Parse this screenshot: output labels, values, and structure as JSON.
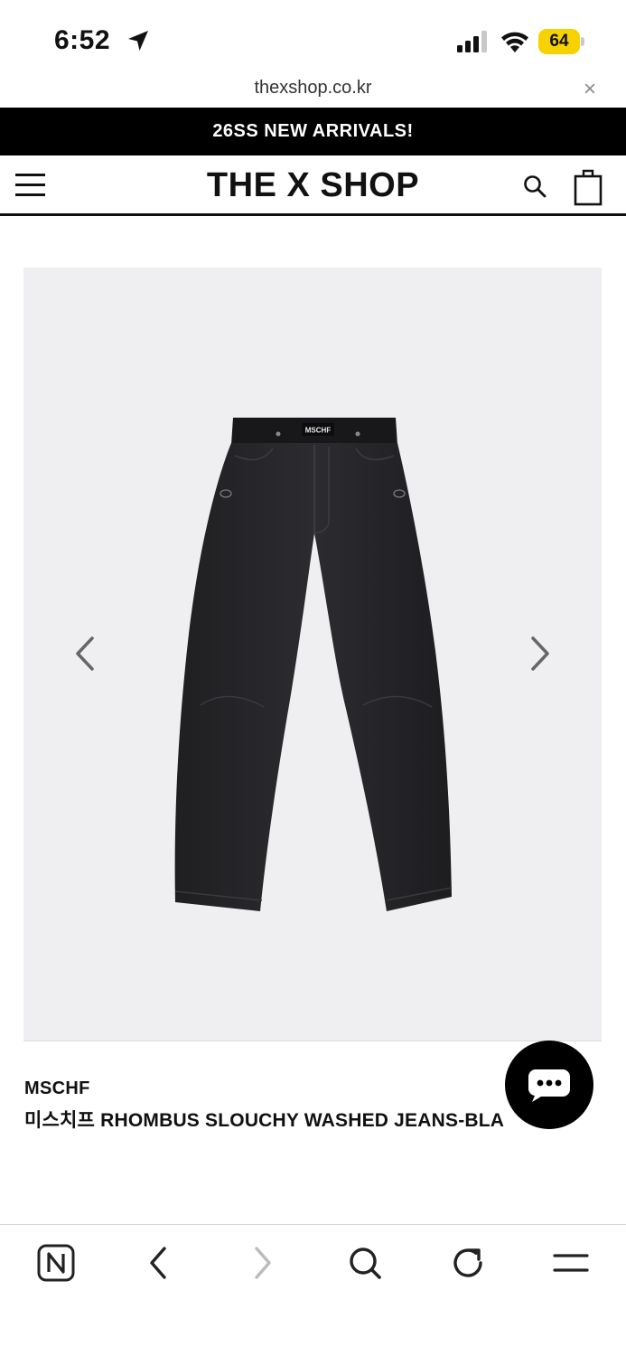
{
  "status_bar": {
    "time": "6:52",
    "battery_level": "64",
    "battery_color": "#f5d200",
    "icons": [
      "location-arrow-icon",
      "cellular-signal-icon",
      "wifi-icon",
      "battery-icon"
    ]
  },
  "browser": {
    "url": "thexshop.co.kr",
    "close_symbol": "×",
    "toolbar_icons": [
      "naver-home-icon",
      "back-arrow-icon",
      "forward-arrow-icon",
      "search-icon",
      "refresh-icon",
      "menu-icon"
    ]
  },
  "banner": {
    "text": "26SS NEW ARRIVALS!",
    "background": "#000000"
  },
  "header": {
    "logo": "THE X SHOP",
    "icons": [
      "hamburger-menu-icon",
      "search-icon",
      "shopping-bag-icon"
    ]
  },
  "product": {
    "image_background": "#efeff1",
    "image_label": "MSCHF",
    "brand": "MSCHF",
    "name": "미스치프 RHOMBUS SLOUCHY WASHED JEANS-BLA",
    "carousel_icons": [
      "chevron-left-icon",
      "chevron-right-icon"
    ]
  },
  "chat": {
    "icon": "chat-bubble-icon"
  }
}
